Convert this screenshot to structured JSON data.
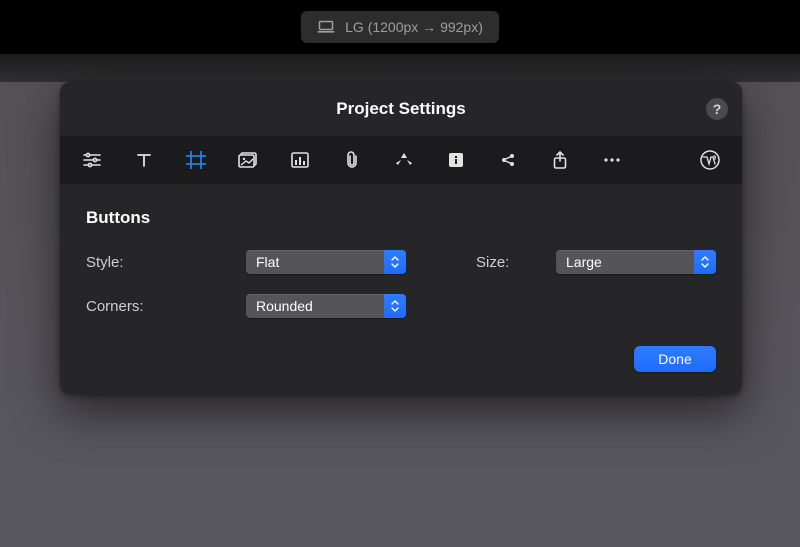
{
  "breakpoint": {
    "label": "LG (1200px → 992px)"
  },
  "panel": {
    "title": "Project Settings",
    "help_label": "?"
  },
  "toolbar_icons": {
    "sliders": "sliders-icon",
    "text": "text-icon",
    "frame": "frame-icon",
    "image": "image-icon",
    "chart": "chart-icon",
    "attachment": "attachment-icon",
    "recycle": "recycle-icon",
    "info": "info-icon",
    "share": "share-icon",
    "export": "export-icon",
    "more": "more-icon",
    "wordpress": "wordpress-icon"
  },
  "section": {
    "title": "Buttons",
    "style_label": "Style:",
    "style_value": "Flat",
    "size_label": "Size:",
    "size_value": "Large",
    "corners_label": "Corners:",
    "corners_value": "Rounded"
  },
  "footer": {
    "done_label": "Done"
  }
}
